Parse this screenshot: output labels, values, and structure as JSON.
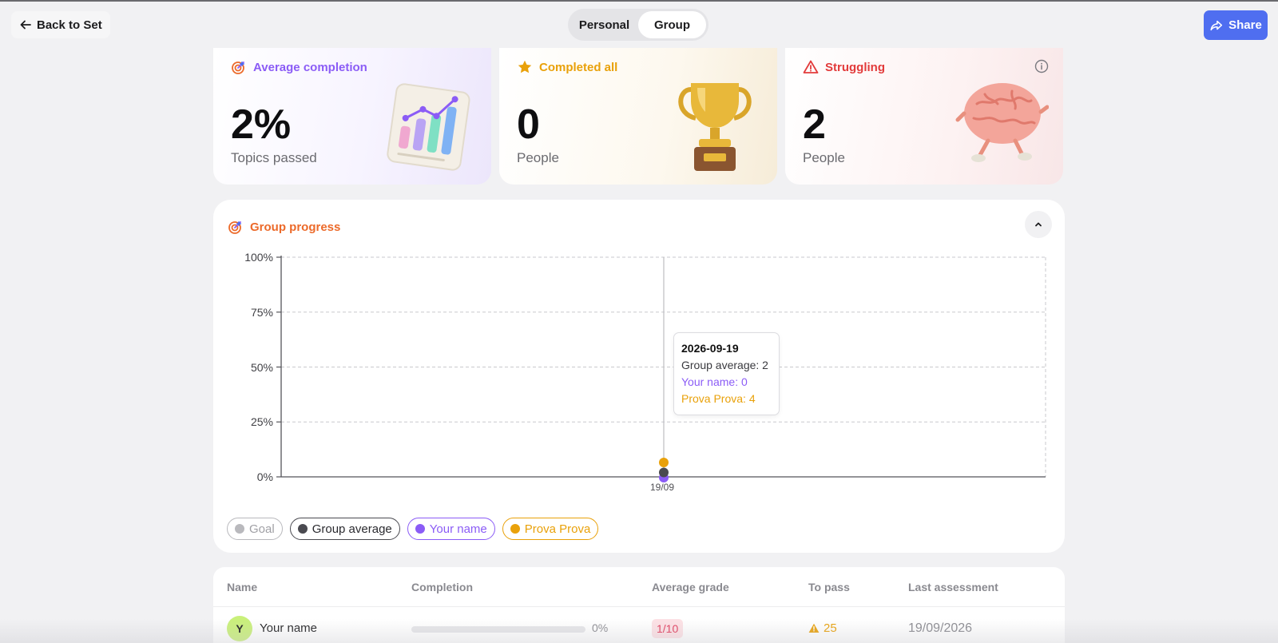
{
  "header": {
    "back_label": "Back to Set",
    "toggle": [
      "Personal",
      "Group"
    ],
    "toggle_active": "Group",
    "share_label": "Share"
  },
  "cards": {
    "average": {
      "label": "Average completion",
      "value": "2%",
      "sub": "Topics passed",
      "color": "#8b5cf6",
      "icon": "target-icon"
    },
    "completed": {
      "label": "Completed all",
      "value": "0",
      "sub": "People",
      "color": "#e9a10a",
      "icon": "star-icon"
    },
    "struggling": {
      "label": "Struggling",
      "value": "2",
      "sub": "People",
      "color": "#e23b3b",
      "icon": "warning-icon"
    }
  },
  "progress": {
    "title": "Group progress",
    "tooltip": {
      "date": "2026-09-19",
      "group_average": "Group average: 2",
      "your_name": "Your name: 0",
      "prova": "Prova Prova: 4"
    },
    "legend": [
      "Goal",
      "Group average",
      "Your name",
      "Prova Prova"
    ]
  },
  "chart_data": {
    "type": "line",
    "x": [
      "19/09"
    ],
    "y_ticks": [
      "100%",
      "75%",
      "50%",
      "25%",
      "0%"
    ],
    "ylim": [
      0,
      100
    ],
    "series": [
      {
        "name": "Group average",
        "values": [
          2
        ],
        "color": "#4a4a50"
      },
      {
        "name": "Your name",
        "values": [
          0
        ],
        "color": "#8b5cf6"
      },
      {
        "name": "Prova Prova",
        "values": [
          4
        ],
        "color": "#e9a10a"
      }
    ],
    "grid": true,
    "legend": "bottom-left"
  },
  "table": {
    "columns": [
      "Name",
      "Completion",
      "Average grade",
      "To pass",
      "Last assessment"
    ],
    "rows": [
      {
        "initial": "Y",
        "name": "Your name",
        "completion": "0%",
        "grade": "1/10",
        "to_pass": "25",
        "last": "19/09/2026"
      }
    ]
  }
}
